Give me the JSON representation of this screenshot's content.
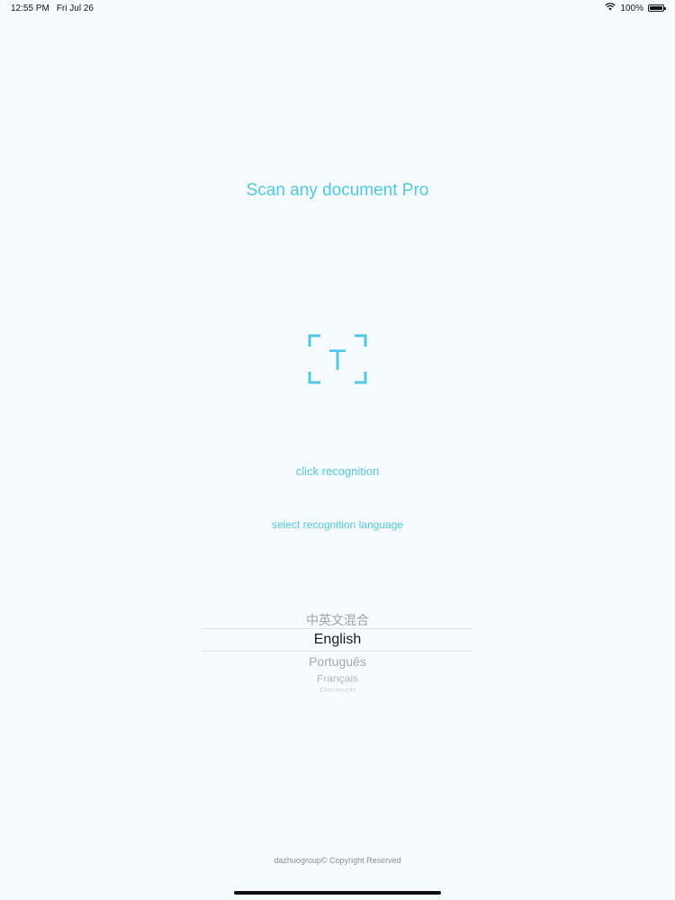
{
  "status_bar": {
    "time": "12:55 PM",
    "date": "Fri Jul 26",
    "battery_text": "100%",
    "battery_level": 1.0
  },
  "app": {
    "title": "Scan any document Pro"
  },
  "scan": {
    "icon_letter": "T",
    "click_label": "click recognition",
    "select_language_label": "select recognition language"
  },
  "language_picker": {
    "options": [
      "中英文混合",
      "English",
      "Português",
      "Français",
      "Deutsch"
    ],
    "selected": "English"
  },
  "footer": {
    "copyright": "dazhuogroup© Copyright Reserved"
  },
  "colors": {
    "accent": "#4fc9e8",
    "background": "#f6fbff"
  }
}
